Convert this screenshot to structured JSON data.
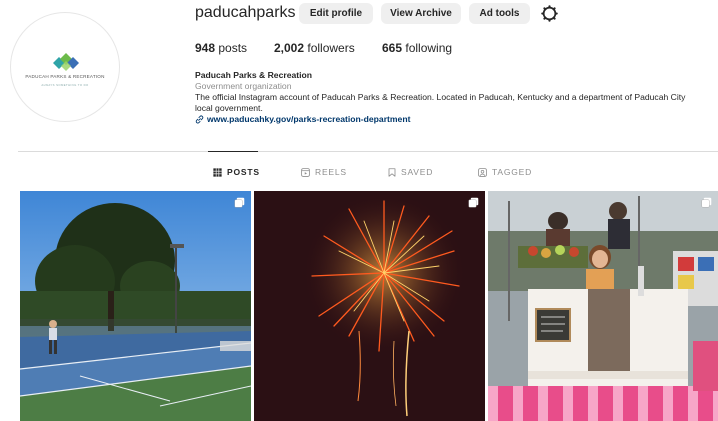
{
  "profile": {
    "username": "paducahparks",
    "avatar_org_text": "PADUCAH PARKS & RECREATION",
    "avatar_tag_text": "ALWAYS SOMETHING TO DO",
    "buttons": {
      "edit_profile": "Edit profile",
      "view_archive": "View Archive",
      "ad_tools": "Ad tools"
    },
    "settings_icon": "gear-icon",
    "stats": {
      "posts_count": "948",
      "posts_label": "posts",
      "followers_count": "2,002",
      "followers_label": "followers",
      "following_count": "665",
      "following_label": "following"
    },
    "bio": {
      "name": "Paducah Parks & Recreation",
      "category": "Government organization",
      "description": "The official Instagram account of Paducah Parks & Recreation. Located in Paducah, Kentucky and a department of Paducah City local government.",
      "link": "www.paducahky.gov/parks-recreation-department"
    }
  },
  "tabs": [
    {
      "label": "POSTS",
      "icon": "grid-icon",
      "active": true
    },
    {
      "label": "REELS",
      "icon": "reels-icon",
      "active": false
    },
    {
      "label": "SAVED",
      "icon": "bookmark-icon",
      "active": false
    },
    {
      "label": "TAGGED",
      "icon": "tagged-icon",
      "active": false
    }
  ],
  "posts": [
    {
      "subject": "tennis court",
      "multi_photo": true
    },
    {
      "subject": "fireworks",
      "multi_photo": true
    },
    {
      "subject": "market vendor booth",
      "multi_photo": true
    }
  ],
  "colors": {
    "link": "#00376b",
    "button_bg": "#efefef",
    "muted": "#8e8e8e",
    "text": "#262626"
  }
}
